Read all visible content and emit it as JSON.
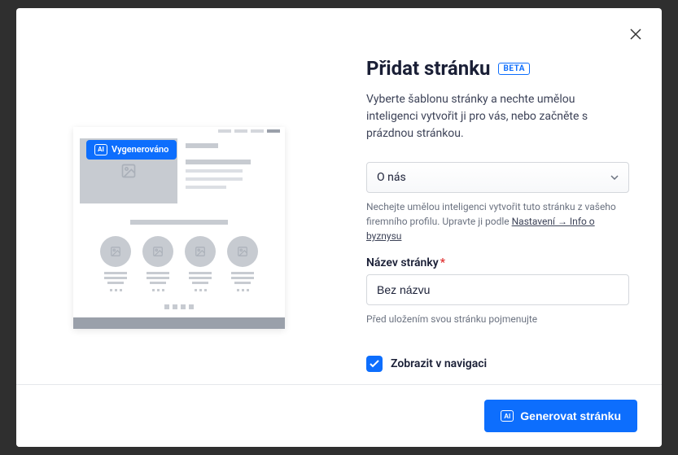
{
  "modal": {
    "title": "Přidat stránku",
    "beta_label": "BETA",
    "description": "Vyberte šablonu stránky a nechte umělou inteligenci vytvořit ji pro vás, nebo začněte s prázdnou stránkou."
  },
  "preview": {
    "badge_label": "Vygenerováno",
    "ai_icon_text": "AI"
  },
  "form": {
    "template_select": {
      "value": "O nás",
      "help_text_prefix": "Nechejte umělou inteligenci vytvořit tuto stránku z vašeho firemního profilu. Upravte ji podle ",
      "help_link": "Nastavení → Info o byznysu"
    },
    "name_field": {
      "label": "Název stránky",
      "value": "Bez názvu",
      "help_text": "Před uložením svou stránku pojmenujte"
    },
    "nav_checkbox": {
      "label": "Zobrazit v navigaci",
      "checked": true
    }
  },
  "footer": {
    "primary_button": "Generovat stránku",
    "ai_icon_text": "AI"
  }
}
